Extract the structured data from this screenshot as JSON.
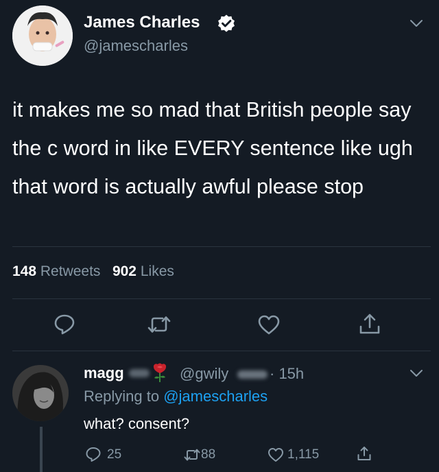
{
  "main_tweet": {
    "display_name": "James Charles",
    "handle": "@jamescharles",
    "text": "it makes me so mad that British people say the c word in like EVERY sentence like ugh that word is actually awful please stop",
    "retweets_count": "148",
    "retweets_label": "Retweets",
    "likes_count": "902",
    "likes_label": "Likes",
    "actions": [
      "reply-icon",
      "retweet-icon",
      "like-icon",
      "share-icon"
    ]
  },
  "reply_tweet": {
    "display_name": "magg",
    "handle": "@gwily",
    "time": "· 15h",
    "replying_prefix": "Replying to",
    "replying_to": "@jamescharles",
    "text": "what? consent?",
    "reply_count": "25",
    "retweet_count": "88",
    "like_count": "1,115"
  },
  "colors": {
    "background": "#141b24",
    "secondary_text": "#8899a6",
    "link": "#1da1f2",
    "verified": "#ffffff"
  }
}
